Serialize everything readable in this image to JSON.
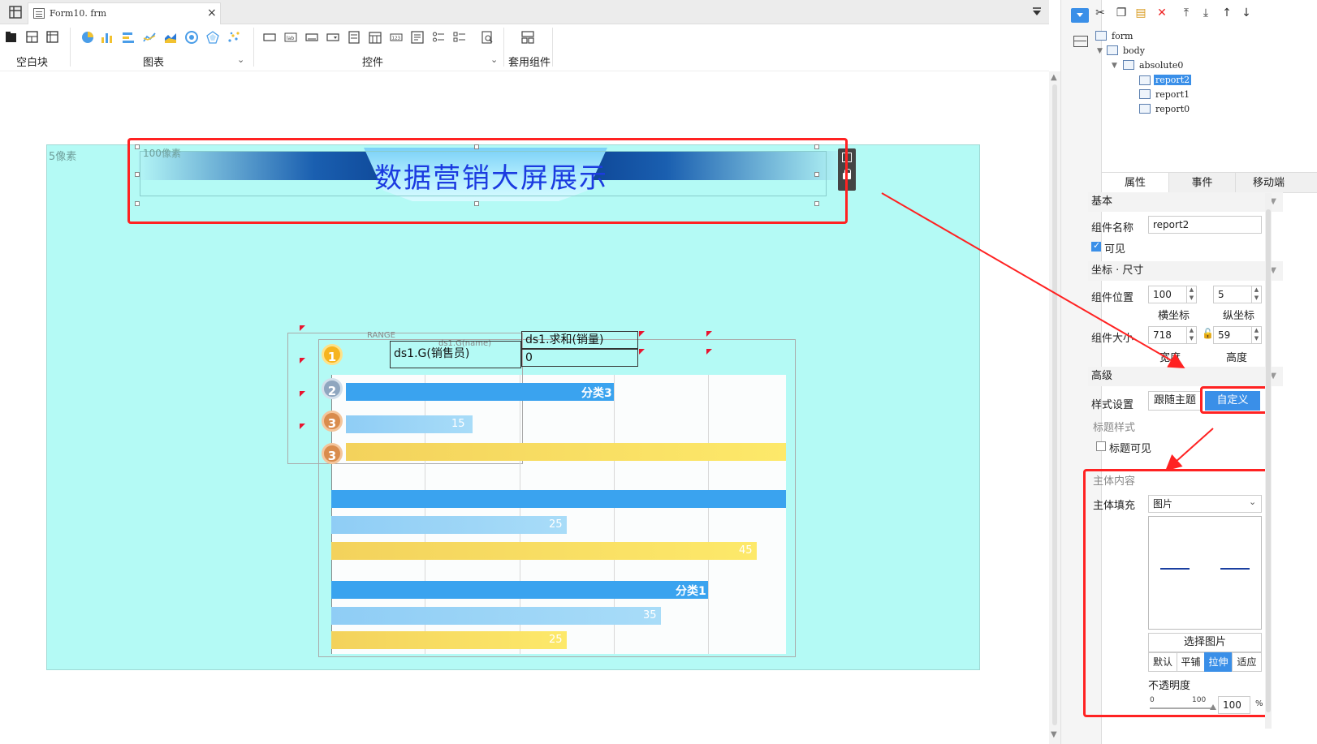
{
  "tab": {
    "filename": "Form10. frm",
    "close": "×"
  },
  "toolbar": {
    "groups": [
      {
        "label": "空白块"
      },
      {
        "label": "图表"
      },
      {
        "label": "控件"
      },
      {
        "label": "套用组件"
      }
    ],
    "chevron": "⌄"
  },
  "canvas": {
    "board_label": "5像素",
    "px_label": "100像素",
    "banner_title": "数据营销大屏展示"
  },
  "report": {
    "medals": [
      "1",
      "2",
      "3",
      "3"
    ],
    "table": {
      "header_left": "ds1.G(销售员)",
      "header_right": "ds1.求和(销量)",
      "value": "0",
      "faint1": "RANGE",
      "faint2": "ds1.G(name)"
    },
    "categories": [
      "分类3",
      "分类1"
    ],
    "bar_labels": [
      "15",
      "25",
      "45",
      "35",
      "25"
    ]
  },
  "tree": {
    "items": [
      {
        "label": "form"
      },
      {
        "label": "body"
      },
      {
        "label": "absolute0"
      },
      {
        "label": "report2"
      },
      {
        "label": "report1"
      },
      {
        "label": "report0"
      }
    ]
  },
  "panel": {
    "tabs": [
      "属性",
      "事件",
      "移动端"
    ],
    "basic": {
      "header": "基本",
      "name_label": "组件名称",
      "name_value": "report2",
      "visible_label": "可见"
    },
    "coords": {
      "header": "坐标 · 尺寸",
      "pos_label": "组件位置",
      "x_value": "100",
      "y_value": "5",
      "x_caption": "横坐标",
      "y_caption": "纵坐标",
      "size_label": "组件大小",
      "w_value": "718",
      "h_value": "59",
      "w_caption": "宽度",
      "h_caption": "高度"
    },
    "advanced": {
      "header": "高级",
      "style_label": "样式设置",
      "follow_theme": "跟随主题",
      "custom": "自定义",
      "title_style": "标题样式",
      "title_visible": "标题可见",
      "body_content": "主体内容",
      "body_fill_label": "主体填充",
      "body_fill_value": "图片",
      "choose_image": "选择图片",
      "modes": [
        "默认",
        "平铺",
        "拉伸",
        "适应"
      ],
      "opacity_label": "不透明度",
      "slider_min": "0",
      "slider_max": "100",
      "opacity_value": "100",
      "opacity_unit": "%"
    }
  },
  "colors": {
    "accent": "#3a8fe8",
    "board": "#b4faf5",
    "highlight": "#ff2222"
  }
}
